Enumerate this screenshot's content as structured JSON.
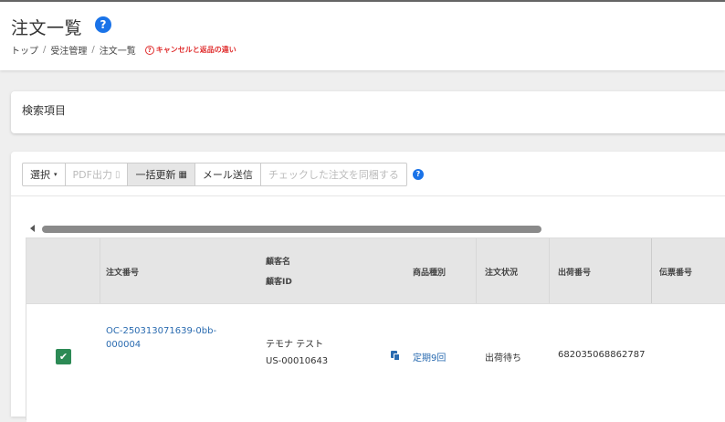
{
  "header": {
    "title": "注文一覧",
    "help_icon": "?",
    "breadcrumb": [
      "トップ",
      "受注管理",
      "注文一覧"
    ],
    "breadcrumb_sep": "/",
    "cancel_link": "キャンセルと返品の違い",
    "cancel_icon": "?"
  },
  "search": {
    "title": "検索項目"
  },
  "toolbar": {
    "select_label": "選択",
    "select_caret": "▾",
    "pdf_label": "PDF出力",
    "bulk_update_label": "一括更新",
    "mail_label": "メール送信",
    "bundle_label": "チェックした注文を同梱する",
    "help_icon": "?"
  },
  "table": {
    "headers": {
      "order_no": "注文番号",
      "customer_name": "顧客名",
      "customer_id": "顧客ID",
      "product_type": "商品種別",
      "order_status": "注文状況",
      "shipment_no": "出荷番号",
      "slip_no": "伝票番号"
    },
    "rows": [
      {
        "checked": true,
        "check_mark": "✔",
        "order_no": "OC-250313071639-0bb-000004",
        "customer_name": "テモナ テスト",
        "customer_id": "US-00010643",
        "product_type": "定期9回",
        "order_status": "出荷待ち",
        "shipment_no": "682035068862787",
        "slip_no": ""
      }
    ]
  },
  "colors": {
    "accent": "#1a73e8",
    "link": "#2a6bb0",
    "check": "#2c8a55",
    "danger": "#e03030"
  }
}
